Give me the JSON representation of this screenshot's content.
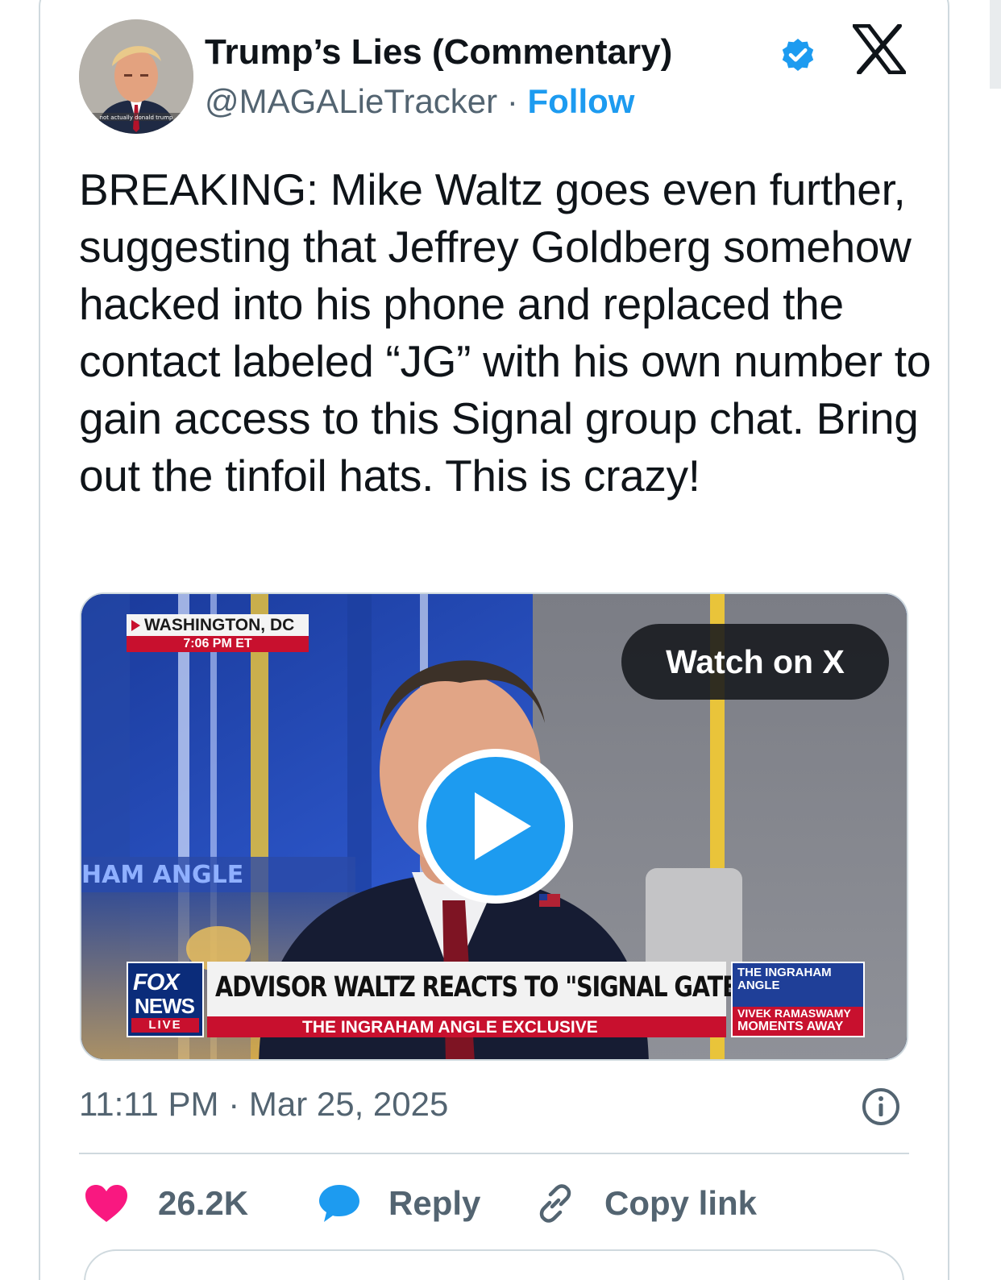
{
  "author": {
    "display_name": "Trump’s Lies (Commentary)",
    "handle": "@MAGALieTracker",
    "separator": " · ",
    "follow_label": "Follow",
    "verified_icon": "verified-badge-icon",
    "avatar_caption": "not actually donald trump"
  },
  "platform_icon": "x-logo-icon",
  "tweet": {
    "text": "BREAKING: Mike Waltz goes even further, suggesting that Jeffrey Goldberg somehow hacked into his phone and replaced the contact labeled “JG” with his own number to gain access to this Signal group chat. Bring out the tinfoil hats. This is crazy!"
  },
  "video": {
    "watch_label": "Watch on X",
    "location": "WASHINGTON, DC",
    "time": "7:06 PM ET",
    "backdrop_text": "HAM ANGLE",
    "network_fox": "FOX",
    "network_news": "NEWS",
    "network_live": "LIVE",
    "headline": "ADVISOR WALTZ REACTS TO \"SIGNAL GATE\"",
    "subheadline": "THE INGRAHAM ANGLE EXCLUSIVE",
    "promo_show": "THE INGRAHAM ANGLE",
    "promo_line1": "VIVEK RAMASWAMY",
    "promo_line2": "MOMENTS AWAY",
    "play_icon": "play-icon"
  },
  "meta": {
    "timestamp": "11:11 PM · Mar 25, 2025",
    "info_icon": "info-icon"
  },
  "actions": {
    "like_count": "26.2K",
    "reply_label": "Reply",
    "copy_label": "Copy link"
  },
  "colors": {
    "accent": "#1d9bf0",
    "text_primary": "#0f1419",
    "text_secondary": "#536471",
    "like": "#f91880",
    "border": "#cfd9de"
  }
}
